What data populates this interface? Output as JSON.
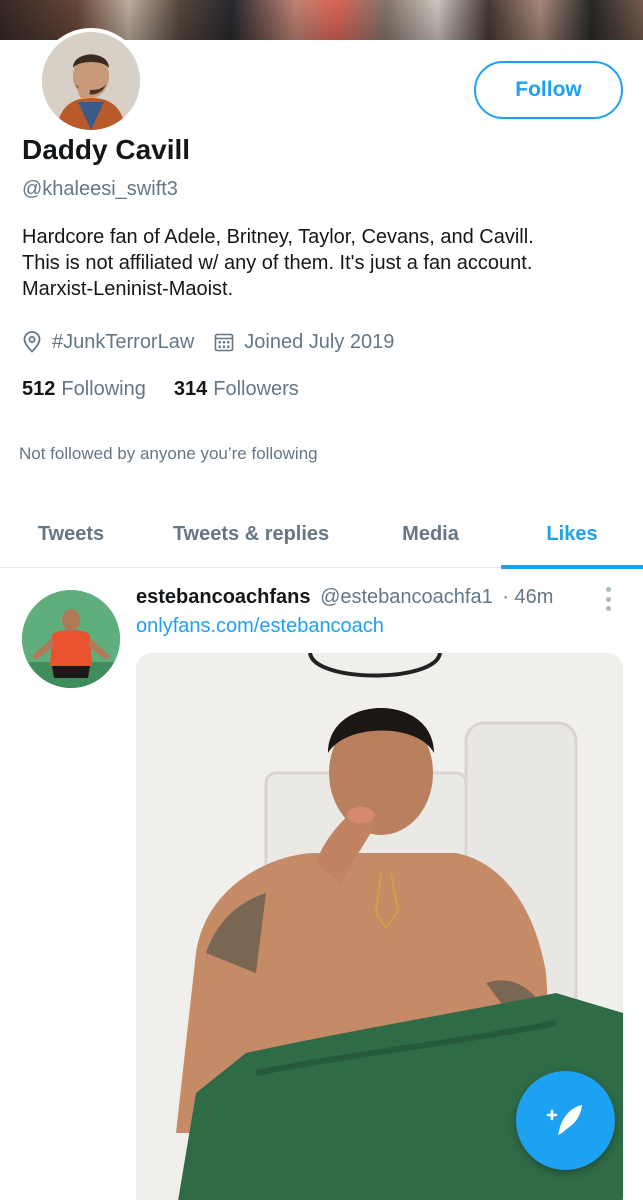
{
  "profile": {
    "display_name": "Daddy Cavill",
    "handle": "@khaleesi_swift3",
    "bio_lines": [
      "Hardcore fan of Adele, Britney, Taylor, Cevans, and Cavill.",
      "This is not affiliated w/ any of them. It's just a fan account.",
      "Marxist-Leninist-Maoist."
    ],
    "location": "#JunkTerrorLaw",
    "joined": "Joined July 2019",
    "following_count": "512",
    "following_label": "Following",
    "followers_count": "314",
    "followers_label": "Followers",
    "followed_note": "Not followed by anyone you’re following",
    "follow_label": "Follow"
  },
  "tabs": [
    {
      "label": "Tweets",
      "active": false
    },
    {
      "label": "Tweets & replies",
      "active": false
    },
    {
      "label": "Media",
      "active": false
    },
    {
      "label": "Likes",
      "active": true
    }
  ],
  "tweet": {
    "author_name": "estebancoachfans",
    "author_handle": "@estebancoachfa1",
    "time": "· 46m",
    "link_text": "onlyfans.com/estebancoach"
  },
  "colors": {
    "accent": "#1da1f2",
    "secondary_text": "#657786",
    "primary_text": "#14171a"
  },
  "icons": {
    "location": "location-pin-icon",
    "joined": "calendar-icon",
    "more": "more-vertical-icon",
    "compose": "compose-tweet-icon"
  }
}
